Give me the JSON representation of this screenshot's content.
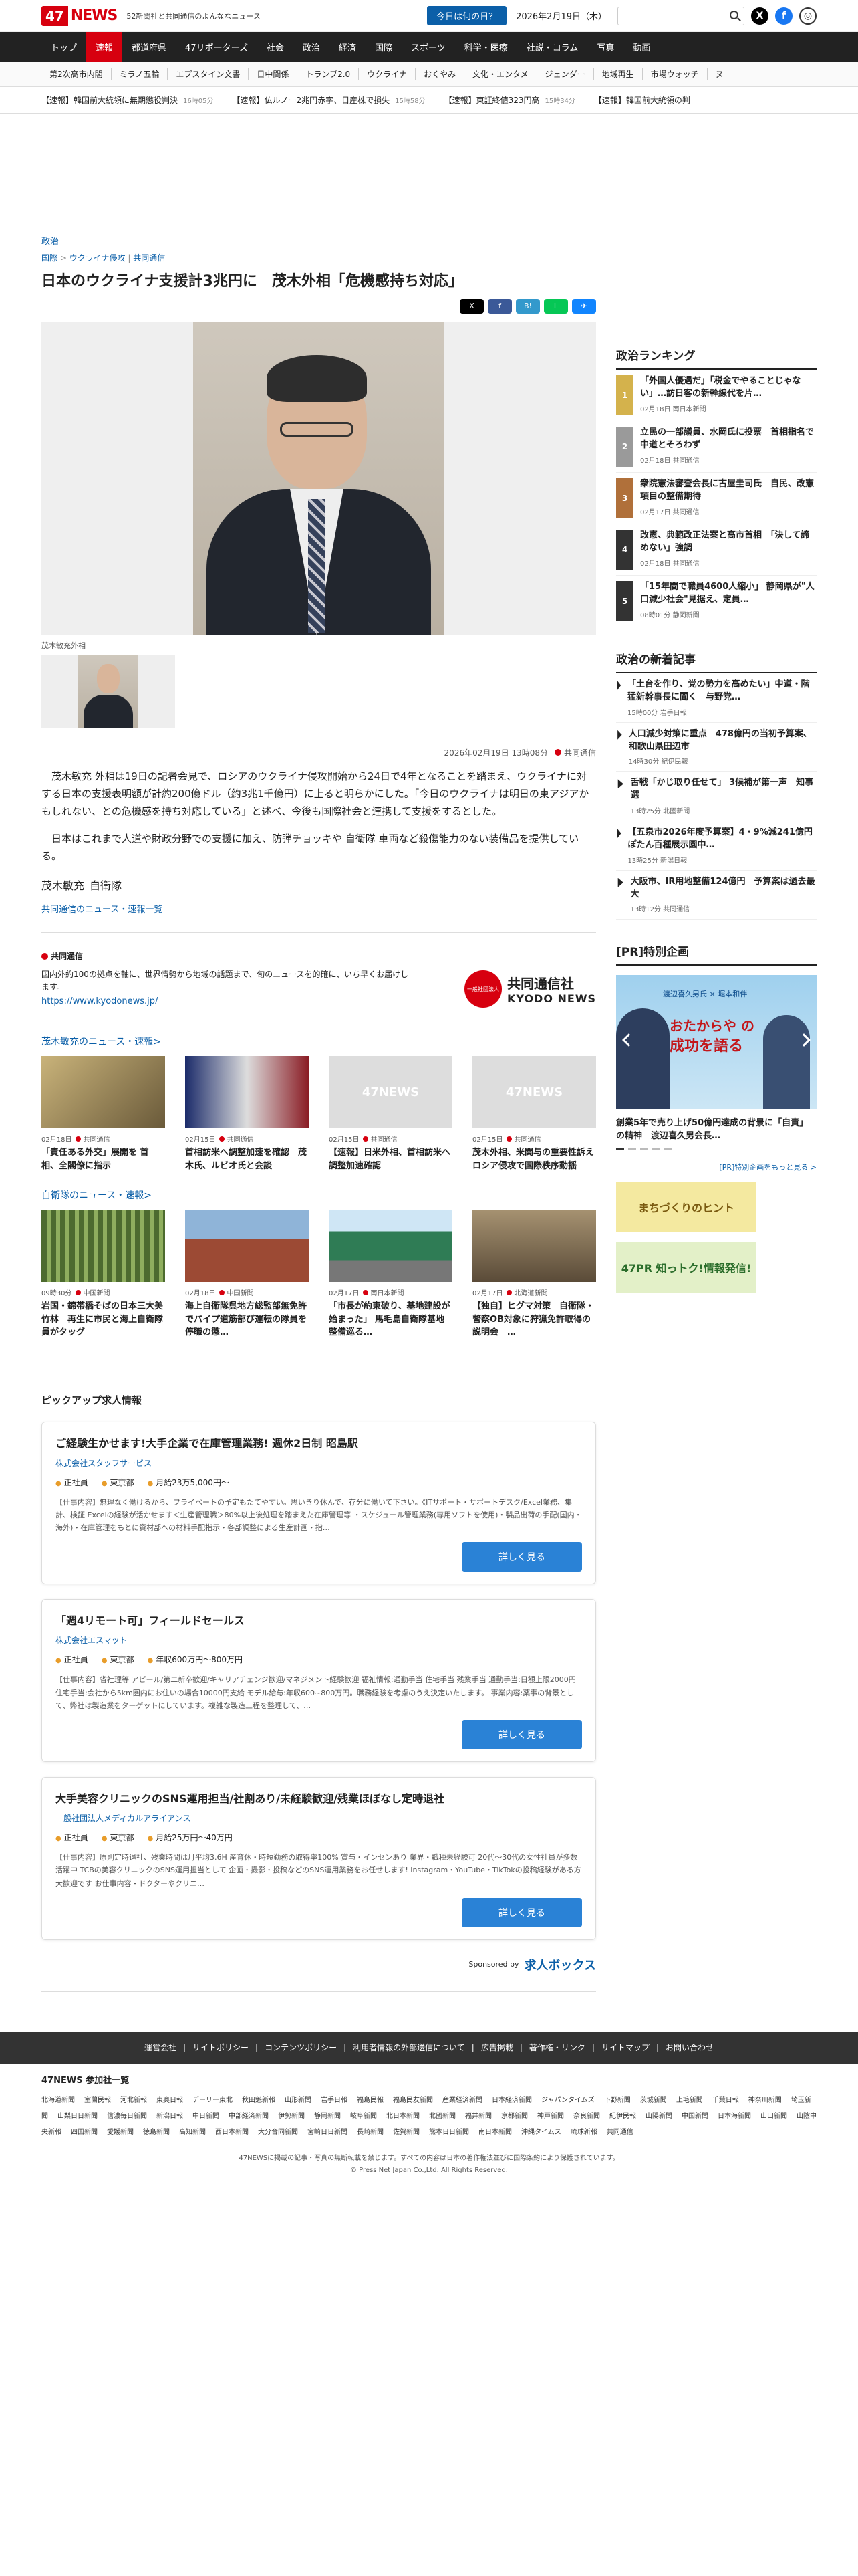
{
  "header": {
    "brand_num": "47",
    "brand_txt": "NEWS",
    "tagline": "52新聞社と共同通信のよんななニュース",
    "today_btn": "今日は何の日？",
    "date": "2026年2月19日（木）",
    "search_placeholder": ""
  },
  "nav": [
    "トップ",
    "速報",
    "都道府県",
    "47リポーターズ",
    "社会",
    "政治",
    "経済",
    "国際",
    "スポーツ",
    "科学・医療",
    "社説・コラム",
    "写真",
    "動画"
  ],
  "subnav": [
    "第2次高市内閣",
    "ミラノ五輪",
    "エプスタイン文書",
    "日中関係",
    "トランプ2.0",
    "ウクライナ",
    "おくやみ",
    "文化・エンタメ",
    "ジェンダー",
    "地域再生",
    "市場ウォッチ",
    "ヌ"
  ],
  "ticker": [
    {
      "t": "【速報】韓国前大統領に無期懲役判決",
      "m": "16時05分"
    },
    {
      "t": "【速報】仏ルノー2兆円赤字、日産株で損失",
      "m": "15時58分"
    },
    {
      "t": "【速報】東証終値323円高",
      "m": "15時34分"
    },
    {
      "t": "【速報】韓国前大統領の判",
      "m": ""
    }
  ],
  "article": {
    "category": "政治",
    "breadcrumb": [
      "国際",
      "ウクライナ侵攻",
      "共同通信"
    ],
    "title": "日本のウクライナ支援計3兆円に　茂木外相「危機感持ち対応」",
    "caption": "茂木敏充外相",
    "datetime": "2026年02月19日 13時08分",
    "source": "共同通信",
    "paragraphs": [
      "茂木敏充 外相は19日の記者会見で、ロシアのウクライナ侵攻開始から24日で4年となることを踏まえ、ウクライナに対する日本の支援表明額が計約200億ドル（約3兆1千億円）に上ると明らかにした。「今日のウクライナは明日の東アジアかもしれない、との危機感を持ち対応している」と述べ、今後も国際社会と連携して支援をするとした。",
      "日本はこれまで人道や財政分野での支援に加え、防弾チョッキや 自衛隊 車両など殺傷能力のない装備品を提供している。"
    ],
    "tags": [
      "茂木敏充",
      "自衛隊"
    ],
    "kyodo_link": "共同通信のニュース・速報一覧"
  },
  "kyodo": {
    "name": "共同通信",
    "desc": "国内外約100の拠点を軸に、世界情勢から地域の話題まで、旬のニュースを的確に、いち早くお届けします。",
    "url": "https://www.kyodonews.jp/",
    "logo_small": "一般社団法人",
    "logo_a": "共同通信社",
    "logo_b": "KYODO NEWS"
  },
  "sec1": {
    "title": "茂木敏充のニュース・速報>",
    "cards": [
      {
        "date": "02月18日",
        "src": "共同通信",
        "title": "「責任ある外交」展開を 首相、全閣僚に指示"
      },
      {
        "date": "02月15日",
        "src": "共同通信",
        "title": "首相訪米へ調整加速を確認　茂木氏、ルビオ氏と会談"
      },
      {
        "date": "02月15日",
        "src": "共同通信",
        "title": "【速報】日米外相、首相訪米へ調整加速確認"
      },
      {
        "date": "02月15日",
        "src": "共同通信",
        "title": "茂木外相、米関与の重要性訴え　ロシア侵攻で国際秩序動揺"
      }
    ]
  },
  "sec2": {
    "title": "自衛隊のニュース・速報>",
    "cards": [
      {
        "date": "09時30分",
        "src": "中国新聞",
        "title": "岩国・錦帯橋そばの日本三大美竹林　再生に市民と海上自衛隊員がタッグ"
      },
      {
        "date": "02月18日",
        "src": "中国新聞",
        "title": "海上自衛隊呉地方総監部無免許でパイプ道筋部び運転の隊員を停職の懲…"
      },
      {
        "date": "02月17日",
        "src": "南日本新聞",
        "title": "「市長が約束破り、基地建設が始まった」 馬毛島自衛隊基地整備巡る…"
      },
      {
        "date": "02月17日",
        "src": "北海道新聞",
        "title": "【独自】ヒグマ対策　自衛隊・警察OB対象に狩猟免許取得の説明会　…"
      }
    ]
  },
  "jobs": {
    "title": "ピックアップ求人情報",
    "items": [
      {
        "title": "ご経験生かせます!大手企業で在庫管理業務! 週休2日制 昭島駅",
        "company": "株式会社スタッフサービス",
        "type": "正社員",
        "loc": "東京都",
        "pay": "月給23万5,000円〜",
        "desc": "【仕事内容】無理なく働けるから、プライベートの予定もたてやすい。思いきり休んで、存分に働いて下さい。《ITサポート・サポートデスク/Excel業務、集計、検証 Excelの経験が活かせます＜生産管理職＞80%以上後処理を踏まえた在庫管理等 ・スケジュール管理業務(専用ソフトを使用)・製品出荷の手配(国内・海外)・在庫管理をもとに資材部への材料手配指示・各部調整による生産計画・指…",
        "btn": "詳しく見る"
      },
      {
        "title": "「週4リモート可」フィールドセールス",
        "company": "株式会社エスマット",
        "type": "正社員",
        "loc": "東京都",
        "pay": "年収600万円〜800万円",
        "desc": "【仕事内容】省社理等 アピール/第二新卒歓迎/キャリアチェンジ歓迎/マネジメント経験歓迎 福祉情報:通勤手当 住宅手当 残業手当 通勤手当:日額上限2000円 住宅手当:会社から5km圏内にお住いの場合10000円支給 モデル給与:年収600~800万円。職務経験を考慮のうえ決定いたします。 事業内容:薬事の背景として、弊社は製造業をターゲットにしています。複雑な製造工程を整理して、…",
        "btn": "詳しく見る"
      },
      {
        "title": "大手美容クリニックのSNS運用担当/社割あり/未経験歓迎/残業ほぼなし定時退社",
        "company": "一般社団法人メディカルアライアンス",
        "type": "正社員",
        "loc": "東京都",
        "pay": "月給25万円〜40万円",
        "desc": "【仕事内容】原則定時退社、残業時間は月平均3.6H 産育休・時短勤務の取得率100% 賞与・インセンあり 業界・職種未経験可 20代〜30代の女性社員が多数活躍中 TCBの美容クリニックのSNS運用担当として 企画・撮影・投稿などのSNS運用業務をお任せします! Instagram・YouTube・TikTokの投稿経験がある方大歓迎です お仕事内容・ドクターやクリニ…",
        "btn": "詳しく見る"
      }
    ],
    "sponsor_label": "Sponsored by",
    "sponsor_name": "求人ボックス"
  },
  "side": {
    "rank_title": "政治ランキング",
    "rank": [
      {
        "n": "1",
        "t": "「外国人優遇だ」「税金でやることじゃない」…訪日客の新幹線代を片…",
        "m": "02月18日 南日本新聞"
      },
      {
        "n": "2",
        "t": "立民の一部議員、水岡氏に投票　首相指名で中道とそろわず",
        "m": "02月18日 共同通信"
      },
      {
        "n": "3",
        "t": "衆院憲法審査会長に古屋圭司氏　自民、改憲項目の整備期待",
        "m": "02月17日 共同通信"
      },
      {
        "n": "4",
        "t": "改憲、典範改正法案と高市首相　「決して諦めない」強調",
        "m": "02月18日 共同通信"
      },
      {
        "n": "5",
        "t": "「15年間で職員4600人縮小」 静岡県が\"人口減少社会\"見据え、定員…",
        "m": "08時01分 静岡新聞"
      }
    ],
    "new_title": "政治の新着記事",
    "news": [
      {
        "t": "「土台を作り、党の勢力を高めたい」中道・階猛新幹事長に聞く　与野党…",
        "m": "15時00分 岩手日報"
      },
      {
        "t": "人口減少対策に重点　478億円の当初予算案、和歌山県田辺市",
        "m": "14時30分 紀伊民報"
      },
      {
        "t": "舌戦「かじ取り任せて」 3候補が第一声　知事選",
        "m": "13時25分 北國新聞"
      },
      {
        "t": "【五泉市2026年度予算案】4・9%減241億円　ぽたん百種展示園中…",
        "m": "13時25分 新潟日報"
      },
      {
        "t": "大阪市、IR用地整備124億円　予算案は過去最大",
        "m": "13時12分 共同通信"
      }
    ],
    "pr_title": "[PR]特別企画",
    "pr_top": "渡辺喜久男氏 × 堀本和伴",
    "pr_big1": "おたからや の",
    "pr_big2": "成功を語る",
    "pr_caption": "創業5年で売り上げ50億円達成の背景に「自責」の精神　渡辺喜久男会長…",
    "pr_more": "[PR]特別企画をもっと見る >",
    "banner1": "まちづくりのヒント",
    "banner2": "47PR 知っトク!情報発信!"
  },
  "footer": {
    "links": [
      "運営会社",
      "サイトポリシー",
      "コンテンツポリシー",
      "利用者情報の外部送信について",
      "広告掲載",
      "著作権・リンク",
      "サイトマップ",
      "お問い合わせ"
    ],
    "members_title": "47NEWS 参加社一覧",
    "members": [
      "北海道新聞",
      "室蘭民報",
      "河北新報",
      "東奥日報",
      "デーリー東北",
      "秋田魁新報",
      "山形新聞",
      "岩手日報",
      "福島民報",
      "福島民友新聞",
      "産業経済新聞",
      "日本経済新聞",
      "ジャパンタイムズ",
      "下野新聞",
      "茨城新聞",
      "上毛新聞",
      "千葉日報",
      "神奈川新聞",
      "埼玉新聞",
      "山梨日日新聞",
      "信濃毎日新聞",
      "新潟日報",
      "中日新聞",
      "中部経済新聞",
      "伊勢新聞",
      "静岡新聞",
      "岐阜新聞",
      "北日本新聞",
      "北國新聞",
      "福井新聞",
      "京都新聞",
      "神戸新聞",
      "奈良新聞",
      "紀伊民報",
      "山陽新聞",
      "中国新聞",
      "日本海新聞",
      "山口新聞",
      "山陰中央新報",
      "四国新聞",
      "愛媛新聞",
      "徳島新聞",
      "高知新聞",
      "西日本新聞",
      "大分合同新聞",
      "宮崎日日新聞",
      "長崎新聞",
      "佐賀新聞",
      "熊本日日新聞",
      "南日本新聞",
      "沖縄タイムス",
      "琉球新報",
      "共同通信"
    ],
    "copy1": "47NEWSに掲載の記事・写真の無断転載を禁じます。すべての内容は日本の著作権法並びに国際条約により保護されています。",
    "copy2": "© Press Net Japan Co.,Ltd. All Rights Reserved."
  },
  "colors": {
    "brand": "#d7000f",
    "link": "#0b5fa8",
    "nav": "#222222"
  }
}
